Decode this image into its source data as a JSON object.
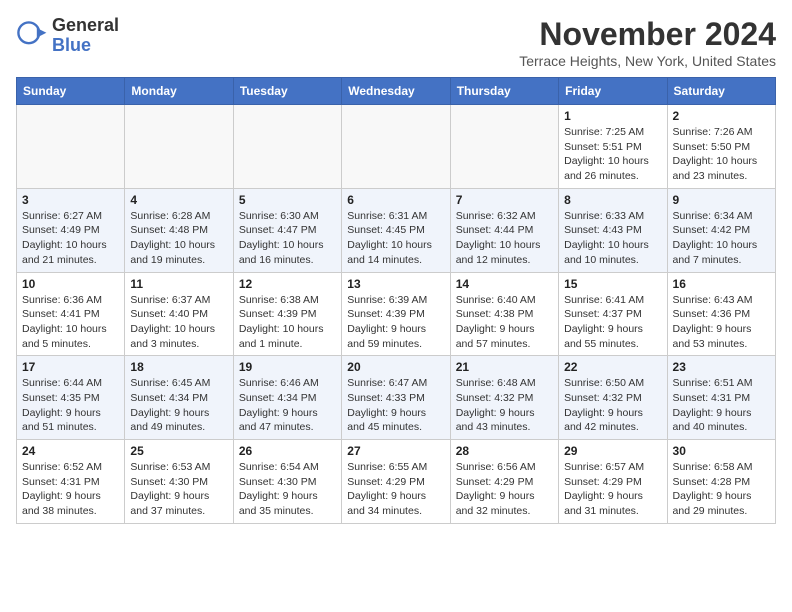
{
  "header": {
    "logo_general": "General",
    "logo_blue": "Blue",
    "month_title": "November 2024",
    "location": "Terrace Heights, New York, United States"
  },
  "days_of_week": [
    "Sunday",
    "Monday",
    "Tuesday",
    "Wednesday",
    "Thursday",
    "Friday",
    "Saturday"
  ],
  "weeks": [
    [
      {
        "day": "",
        "info": ""
      },
      {
        "day": "",
        "info": ""
      },
      {
        "day": "",
        "info": ""
      },
      {
        "day": "",
        "info": ""
      },
      {
        "day": "",
        "info": ""
      },
      {
        "day": "1",
        "info": "Sunrise: 7:25 AM\nSunset: 5:51 PM\nDaylight: 10 hours and 26 minutes."
      },
      {
        "day": "2",
        "info": "Sunrise: 7:26 AM\nSunset: 5:50 PM\nDaylight: 10 hours and 23 minutes."
      }
    ],
    [
      {
        "day": "3",
        "info": "Sunrise: 6:27 AM\nSunset: 4:49 PM\nDaylight: 10 hours and 21 minutes."
      },
      {
        "day": "4",
        "info": "Sunrise: 6:28 AM\nSunset: 4:48 PM\nDaylight: 10 hours and 19 minutes."
      },
      {
        "day": "5",
        "info": "Sunrise: 6:30 AM\nSunset: 4:47 PM\nDaylight: 10 hours and 16 minutes."
      },
      {
        "day": "6",
        "info": "Sunrise: 6:31 AM\nSunset: 4:45 PM\nDaylight: 10 hours and 14 minutes."
      },
      {
        "day": "7",
        "info": "Sunrise: 6:32 AM\nSunset: 4:44 PM\nDaylight: 10 hours and 12 minutes."
      },
      {
        "day": "8",
        "info": "Sunrise: 6:33 AM\nSunset: 4:43 PM\nDaylight: 10 hours and 10 minutes."
      },
      {
        "day": "9",
        "info": "Sunrise: 6:34 AM\nSunset: 4:42 PM\nDaylight: 10 hours and 7 minutes."
      }
    ],
    [
      {
        "day": "10",
        "info": "Sunrise: 6:36 AM\nSunset: 4:41 PM\nDaylight: 10 hours and 5 minutes."
      },
      {
        "day": "11",
        "info": "Sunrise: 6:37 AM\nSunset: 4:40 PM\nDaylight: 10 hours and 3 minutes."
      },
      {
        "day": "12",
        "info": "Sunrise: 6:38 AM\nSunset: 4:39 PM\nDaylight: 10 hours and 1 minute."
      },
      {
        "day": "13",
        "info": "Sunrise: 6:39 AM\nSunset: 4:39 PM\nDaylight: 9 hours and 59 minutes."
      },
      {
        "day": "14",
        "info": "Sunrise: 6:40 AM\nSunset: 4:38 PM\nDaylight: 9 hours and 57 minutes."
      },
      {
        "day": "15",
        "info": "Sunrise: 6:41 AM\nSunset: 4:37 PM\nDaylight: 9 hours and 55 minutes."
      },
      {
        "day": "16",
        "info": "Sunrise: 6:43 AM\nSunset: 4:36 PM\nDaylight: 9 hours and 53 minutes."
      }
    ],
    [
      {
        "day": "17",
        "info": "Sunrise: 6:44 AM\nSunset: 4:35 PM\nDaylight: 9 hours and 51 minutes."
      },
      {
        "day": "18",
        "info": "Sunrise: 6:45 AM\nSunset: 4:34 PM\nDaylight: 9 hours and 49 minutes."
      },
      {
        "day": "19",
        "info": "Sunrise: 6:46 AM\nSunset: 4:34 PM\nDaylight: 9 hours and 47 minutes."
      },
      {
        "day": "20",
        "info": "Sunrise: 6:47 AM\nSunset: 4:33 PM\nDaylight: 9 hours and 45 minutes."
      },
      {
        "day": "21",
        "info": "Sunrise: 6:48 AM\nSunset: 4:32 PM\nDaylight: 9 hours and 43 minutes."
      },
      {
        "day": "22",
        "info": "Sunrise: 6:50 AM\nSunset: 4:32 PM\nDaylight: 9 hours and 42 minutes."
      },
      {
        "day": "23",
        "info": "Sunrise: 6:51 AM\nSunset: 4:31 PM\nDaylight: 9 hours and 40 minutes."
      }
    ],
    [
      {
        "day": "24",
        "info": "Sunrise: 6:52 AM\nSunset: 4:31 PM\nDaylight: 9 hours and 38 minutes."
      },
      {
        "day": "25",
        "info": "Sunrise: 6:53 AM\nSunset: 4:30 PM\nDaylight: 9 hours and 37 minutes."
      },
      {
        "day": "26",
        "info": "Sunrise: 6:54 AM\nSunset: 4:30 PM\nDaylight: 9 hours and 35 minutes."
      },
      {
        "day": "27",
        "info": "Sunrise: 6:55 AM\nSunset: 4:29 PM\nDaylight: 9 hours and 34 minutes."
      },
      {
        "day": "28",
        "info": "Sunrise: 6:56 AM\nSunset: 4:29 PM\nDaylight: 9 hours and 32 minutes."
      },
      {
        "day": "29",
        "info": "Sunrise: 6:57 AM\nSunset: 4:29 PM\nDaylight: 9 hours and 31 minutes."
      },
      {
        "day": "30",
        "info": "Sunrise: 6:58 AM\nSunset: 4:28 PM\nDaylight: 9 hours and 29 minutes."
      }
    ]
  ]
}
